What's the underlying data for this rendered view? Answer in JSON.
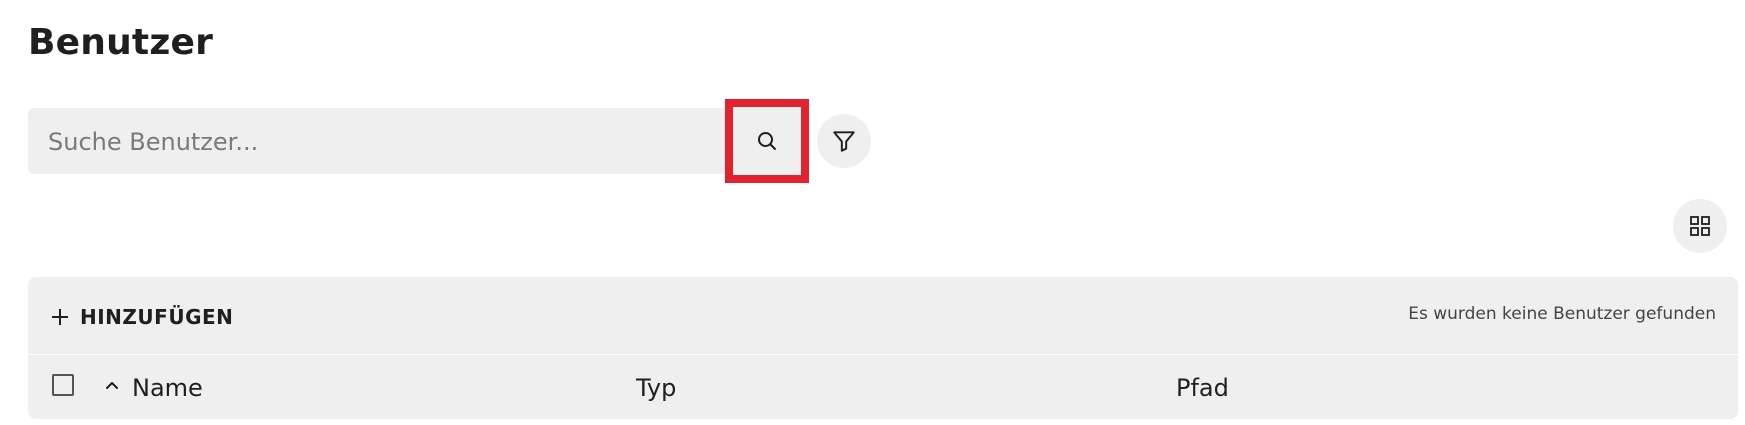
{
  "page": {
    "title": "Benutzer"
  },
  "search": {
    "placeholder": "Suche Benutzer...",
    "value": ""
  },
  "icons": {
    "search": "search-icon",
    "filter": "filter-icon",
    "view": "grid-view-icon",
    "add": "plus-icon",
    "sort": "chevron-up-icon"
  },
  "colors": {
    "highlight": "#e0232e",
    "panel": "#efefef"
  },
  "toolbar": {
    "add_label": "HINZUFÜGEN",
    "empty_message": "Es wurden keine Benutzer gefunden"
  },
  "table": {
    "columns": [
      "Name",
      "Typ",
      "Pfad"
    ],
    "rows": []
  }
}
